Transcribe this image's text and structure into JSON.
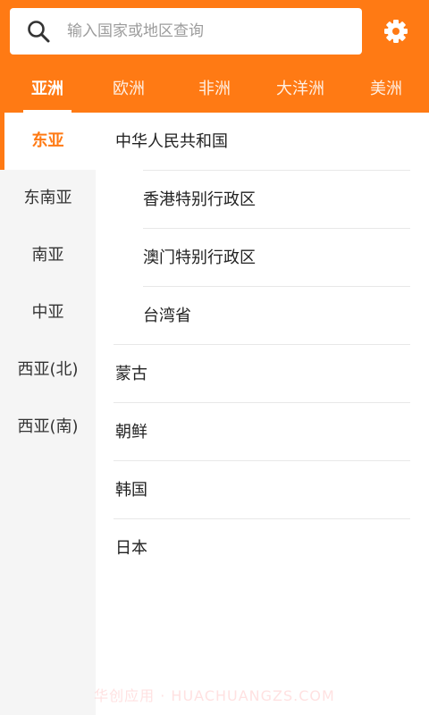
{
  "search": {
    "placeholder": "输入国家或地区查询"
  },
  "colors": {
    "accent": "#FF7A14",
    "sidebar_bg": "#F5F5F5"
  },
  "icons": {
    "search": "search-icon",
    "settings": "gear-icon"
  },
  "continent_tabs": [
    {
      "label": "亚洲",
      "active": true
    },
    {
      "label": "欧洲",
      "active": false
    },
    {
      "label": "非洲",
      "active": false
    },
    {
      "label": "大洋洲",
      "active": false
    },
    {
      "label": "美洲",
      "active": false
    }
  ],
  "regions": [
    {
      "label": "东亚",
      "active": true
    },
    {
      "label": "东南亚",
      "active": false
    },
    {
      "label": "南亚",
      "active": false
    },
    {
      "label": "中亚",
      "active": false
    },
    {
      "label": "西亚(北)",
      "active": false
    },
    {
      "label": "西亚(南)",
      "active": false
    }
  ],
  "countries": [
    {
      "label": "中华人民共和国",
      "level": 0
    },
    {
      "label": "香港特别行政区",
      "level": 1
    },
    {
      "label": "澳门特别行政区",
      "level": 1
    },
    {
      "label": "台湾省",
      "level": 1
    },
    {
      "label": "蒙古",
      "level": 0
    },
    {
      "label": "朝鲜",
      "level": 0
    },
    {
      "label": "韩国",
      "level": 0
    },
    {
      "label": "日本",
      "level": 0
    }
  ],
  "watermark": "华创应用 · HUACHUANGZS.COM"
}
